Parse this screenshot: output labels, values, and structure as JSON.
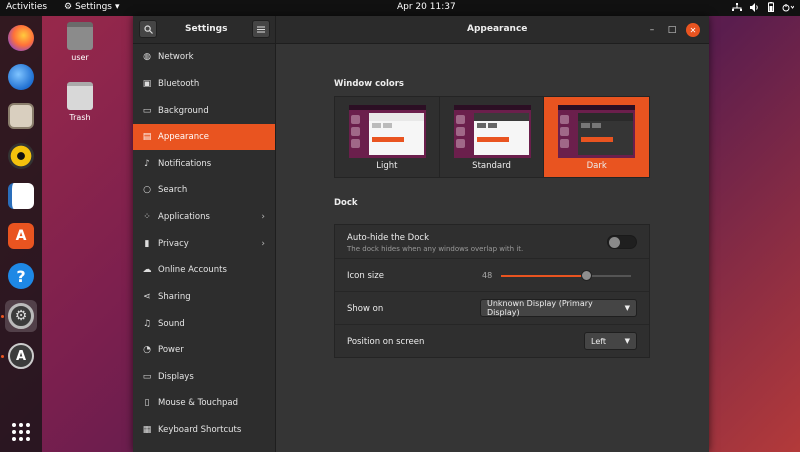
{
  "topbar": {
    "activities": "Activities",
    "app_menu": "Settings",
    "app_menu_arrow": "▾",
    "clock": "Apr 20  11:37",
    "tray_icons": [
      "network-icon",
      "volume-icon",
      "battery-icon",
      "power-icon"
    ]
  },
  "desktop": {
    "home_label": "user",
    "trash_label": "Trash"
  },
  "dock": {
    "items": [
      "firefox",
      "thunderbird",
      "files",
      "rhythmbox",
      "writer",
      "software",
      "help",
      "settings",
      "updater"
    ],
    "show_apps": "show-apps-grid"
  },
  "window": {
    "sidebar_title": "Settings",
    "main_title": "Appearance",
    "search_icon": "search-icon",
    "menu_icon": "hamburger-menu-icon",
    "minimize": "–",
    "maximize": "□",
    "close": "✕"
  },
  "sidebar": {
    "items": [
      {
        "label": "Network",
        "icon": "network-icon"
      },
      {
        "label": "Bluetooth",
        "icon": "bluetooth-icon"
      },
      {
        "label": "Background",
        "icon": "background-icon"
      },
      {
        "label": "Appearance",
        "icon": "appearance-icon"
      },
      {
        "label": "Notifications",
        "icon": "bell-icon"
      },
      {
        "label": "Search",
        "icon": "search-icon"
      },
      {
        "label": "Applications",
        "icon": "applications-icon"
      },
      {
        "label": "Privacy",
        "icon": "privacy-icon"
      },
      {
        "label": "Online Accounts",
        "icon": "cloud-icon"
      },
      {
        "label": "Sharing",
        "icon": "share-icon"
      },
      {
        "label": "Sound",
        "icon": "music-note-icon"
      },
      {
        "label": "Power",
        "icon": "power-icon"
      },
      {
        "label": "Displays",
        "icon": "display-icon"
      },
      {
        "label": "Mouse & Touchpad",
        "icon": "mouse-icon"
      },
      {
        "label": "Keyboard Shortcuts",
        "icon": "keyboard-icon"
      }
    ],
    "chevron": "›"
  },
  "appearance": {
    "window_colors_title": "Window colors",
    "colors": [
      {
        "label": "Light"
      },
      {
        "label": "Standard"
      },
      {
        "label": "Dark"
      }
    ],
    "dock_title": "Dock",
    "autohide_label": "Auto-hide the Dock",
    "autohide_sub": "The dock hides when any windows overlap with it.",
    "icon_size_label": "Icon size",
    "icon_size_value": "48",
    "show_on_label": "Show on",
    "show_on_value": "Unknown Display (Primary Display)",
    "position_label": "Position on screen",
    "position_value": "Left",
    "combo_arrow": "▼"
  },
  "colors": {
    "accent": "#e95420"
  }
}
